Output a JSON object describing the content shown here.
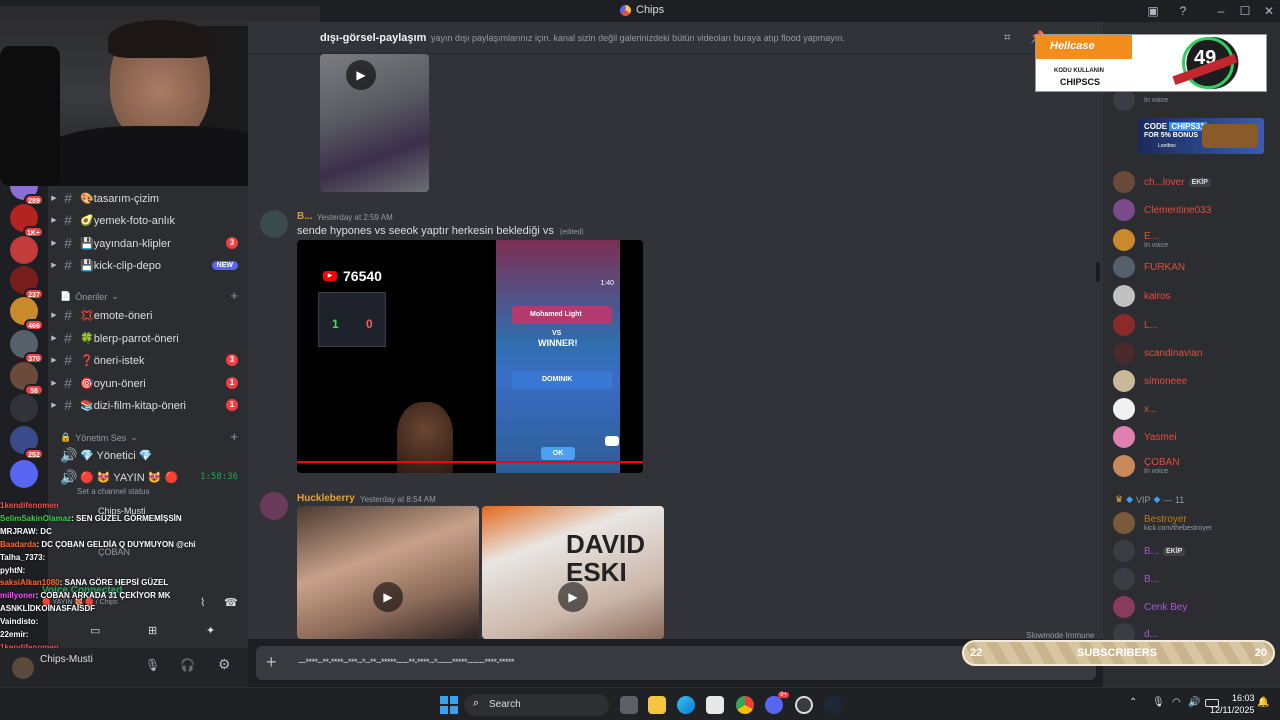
{
  "window": {
    "title": "Chips"
  },
  "servers": [
    {
      "badge": "289",
      "color": "#8b6fd4"
    },
    {
      "badge": "1K+",
      "color": "#b3231f"
    },
    {
      "badge": "",
      "color": "#c43b3b"
    },
    {
      "badge": "237",
      "color": "#7a1d1d"
    },
    {
      "badge": "466",
      "color": "#c98a2b"
    },
    {
      "badge": "370",
      "color": "#55606b"
    },
    {
      "badge": "58",
      "color": "#6a4a3a"
    },
    {
      "badge": "",
      "color": "#313338"
    },
    {
      "badge": "252",
      "color": "#3b4a8a"
    },
    {
      "badge": "",
      "color": "#5865f2"
    }
  ],
  "channels": [
    {
      "emoji": "🎨",
      "label": "tasarım-çizim",
      "count": "",
      "new": ""
    },
    {
      "emoji": "🥑",
      "label": "yemek-foto-anlık",
      "count": "",
      "new": ""
    },
    {
      "emoji": "💾",
      "label": "yayından-klipler",
      "count": "3",
      "new": ""
    },
    {
      "emoji": "💾",
      "label": "kick-clip-depo",
      "count": "",
      "new": "NEW"
    }
  ],
  "category_oneriler": "Öneriler",
  "channels2": [
    {
      "emoji": "💢",
      "label": "emote-öneri",
      "count": ""
    },
    {
      "emoji": "🍀",
      "label": "blerp-parrot-öneri",
      "count": ""
    },
    {
      "emoji": "❓",
      "label": "öneri-istek",
      "count": "3"
    },
    {
      "emoji": "🎯",
      "label": "oyun-öneri",
      "count": "1"
    },
    {
      "emoji": "📚",
      "label": "dizi-film-kitap-öneri",
      "count": "1"
    }
  ],
  "category_yonetim": "Yönetim Ses",
  "voice": {
    "channel1": "💎 Yönetici 💎",
    "channel2": "🔴 😻 YAYIN 😻 🔴",
    "timer": "1:58:36",
    "status_hint": "Set a channel status",
    "connected": "Voice Connected",
    "connected_sub": "🔴 YAYIN 😻 🔴 / Chips",
    "user_a": "Chips-Musti",
    "user_b": "ÇOBAN"
  },
  "user_panel": {
    "name": "Chips-Musti"
  },
  "chat_overlay": [
    {
      "user": "1kendifenomen",
      "msg": "",
      "color": "#ff4b4b"
    },
    {
      "user": "SelimSakinOlamaz",
      "msg": ": SEN GÜZEL GÖRMEMİŞSİN",
      "color": "#3fd14a"
    },
    {
      "user": "MRJRAW",
      "msg": ": DC",
      "color": "#ffffff"
    },
    {
      "user": "Baadarda",
      "msg": ": DC ÇOBAN GELDİA Q DUYMUYON @chips",
      "color": "#ff6b2b"
    },
    {
      "user": "Talha_7373",
      "msg": ":",
      "color": "#ffffff"
    },
    {
      "user": "pyhtN",
      "msg": ":",
      "color": "#ffffff"
    },
    {
      "user": "saksiAlkan1080",
      "msg": ": SANA GÖRE HEPSİ GÜZEL",
      "color": "#ff6b2b"
    },
    {
      "user": "",
      "msg": "",
      "color": "#ffffff"
    },
    {
      "user": "millyoner",
      "msg": ": COBAN ARKADA 31 ÇEKİYOR MK",
      "color": "#ff4bff"
    },
    {
      "user": "ASNKLİDKO",
      "msg": "İNASFAİSDF",
      "color": "#ffffff"
    },
    {
      "user": "Vaindisto",
      "msg": ":",
      "color": "#ffffff"
    },
    {
      "user": "22emir",
      "msg": ":",
      "color": "#ffffff"
    },
    {
      "user": "1kendifenomen",
      "msg": "",
      "color": "#ff4b4b"
    }
  ],
  "header": {
    "channel": "dışı-görsel-paylaşım",
    "topic": "yayın dışı paylaşımlarınız için. kanal sizin değil galerinizdeki bütün videoları buraya atıp flood yapmayın."
  },
  "messages": [
    {
      "author": "B...",
      "author_color": "#c9a227",
      "time": "Yesterday at 2:59 AM",
      "text": "sende hypones vs seeok yaptır herkesin beklediği vs",
      "edited": "(edited)",
      "counter": "76540",
      "timer": "1:40",
      "vs": "VS",
      "winner": "WINNER!",
      "player1": "Mohamed Light",
      "player2": "DOMINIK",
      "ok": "OK"
    },
    {
      "author": "Huckleberry",
      "author_color": "#e8a23a",
      "time": "Yesterday at 8:54 AM",
      "image_text": "DAVID\nESKI"
    }
  ],
  "slowmode": "Slowmode Immune",
  "composer_text": "---****--**-****--***--*--**--*****-----**-****--*------*****-------****-*****",
  "members": [
    {
      "name": "",
      "sub": "In voice",
      "color": "#dbdee1",
      "tag": ""
    },
    {
      "name": "ch...lover",
      "sub": "",
      "color": "#e74c3c",
      "tag": "EKİP"
    },
    {
      "name": "Clementine033",
      "sub": "",
      "color": "#e74c3c",
      "tag": ""
    },
    {
      "name": "E...",
      "sub": "In voice",
      "color": "#e74c3c",
      "tag": ""
    },
    {
      "name": "FURKAN",
      "sub": "",
      "color": "#e74c3c",
      "tag": ""
    },
    {
      "name": "kairos",
      "sub": "",
      "color": "#e74c3c",
      "tag": ""
    },
    {
      "name": "L...",
      "sub": "",
      "color": "#e74c3c",
      "tag": ""
    },
    {
      "name": "scandinavian",
      "sub": "",
      "color": "#e74c3c",
      "tag": ""
    },
    {
      "name": "simoneee",
      "sub": "",
      "color": "#e74c3c",
      "tag": ""
    },
    {
      "name": "x...",
      "sub": "",
      "color": "#e74c3c",
      "tag": ""
    },
    {
      "name": "Yasmei",
      "sub": "",
      "color": "#e74c3c",
      "tag": ""
    },
    {
      "name": "ÇOBAN",
      "sub": "In voice",
      "color": "#e74c3c",
      "tag": ""
    }
  ],
  "vip_header": "VIP",
  "vip_count": "— 11",
  "vip_members": [
    {
      "name": "Bestroyer",
      "sub": "kick.com/thebestroyer",
      "color": "#c27c0e",
      "tag": ""
    },
    {
      "name": "B...",
      "sub": "",
      "color": "#a55bd1",
      "tag": "EKİP"
    },
    {
      "name": "B...",
      "sub": "",
      "color": "#a55bd1",
      "tag": ""
    },
    {
      "name": "Cenk Bey",
      "sub": "",
      "color": "#a55bd1",
      "tag": ""
    },
    {
      "name": "d...",
      "sub": "",
      "color": "#a55bd1",
      "tag": ""
    }
  ],
  "hellcase": {
    "brand": "Hellcase",
    "line1": "KODU KULLANIN",
    "line2": "CHIPSCS",
    "number": "49"
  },
  "ad2": {
    "line1": "CODE",
    "code": "CHIPS31",
    "line2": "FOR 5% BONUS",
    "brand": "Lootbox"
  },
  "subs": {
    "left": "22",
    "label": "SUBSCRIBERS",
    "right": "20"
  },
  "taskbar": {
    "search": "Search",
    "time": "16:03",
    "date": "12/11/2025",
    "discord_badge": "9+"
  }
}
